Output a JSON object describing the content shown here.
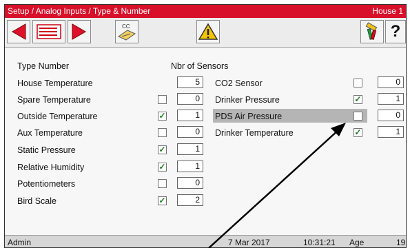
{
  "titlebar": {
    "breadcrumb": "Setup / Analog Inputs / Type & Number",
    "house": "House 1"
  },
  "toolbar": {
    "prev_icon": "left-triangle-icon",
    "list_icon": "list-icon",
    "next_icon": "right-triangle-icon",
    "cc_label": "CC",
    "warning_icon": "warning-icon",
    "tools_icon": "tools-icon",
    "help_label": "?"
  },
  "headers": {
    "type_number": "Type  Number",
    "nbr_sensors": "Nbr of Sensors"
  },
  "left_items": [
    {
      "label": "House Temperature",
      "checkbox": null,
      "value": "5"
    },
    {
      "label": "Spare Temperature",
      "checkbox": false,
      "value": "0"
    },
    {
      "label": "Outside Temperature",
      "checkbox": true,
      "value": "1"
    },
    {
      "label": "Aux Temperature",
      "checkbox": false,
      "value": "0"
    },
    {
      "label": "Static Pressure",
      "checkbox": true,
      "value": "1"
    },
    {
      "label": "Relative Humidity",
      "checkbox": true,
      "value": "1"
    },
    {
      "label": "Potentiometers",
      "checkbox": false,
      "value": "0"
    },
    {
      "label": "Bird Scale",
      "checkbox": true,
      "value": "2"
    }
  ],
  "right_items": [
    {
      "label": "CO2 Sensor",
      "checkbox": false,
      "value": "0",
      "highlighted": false
    },
    {
      "label": "Drinker Pressure",
      "checkbox": true,
      "value": "1",
      "highlighted": false
    },
    {
      "label": "PDS Air Pressure",
      "checkbox": false,
      "value": "0",
      "highlighted": true
    },
    {
      "label": "Drinker Temperature",
      "checkbox": true,
      "value": "1",
      "highlighted": false
    }
  ],
  "statusbar": {
    "user": "Admin",
    "date": "7 Mar 2017",
    "time": "10:31:21",
    "age_label": "Age",
    "age_value": "19"
  },
  "colors": {
    "title_red": "#d8102a",
    "check_green": "#1a7a1a",
    "warning_yellow": "#f5c400",
    "highlight_gray": "#b5b5b5"
  }
}
